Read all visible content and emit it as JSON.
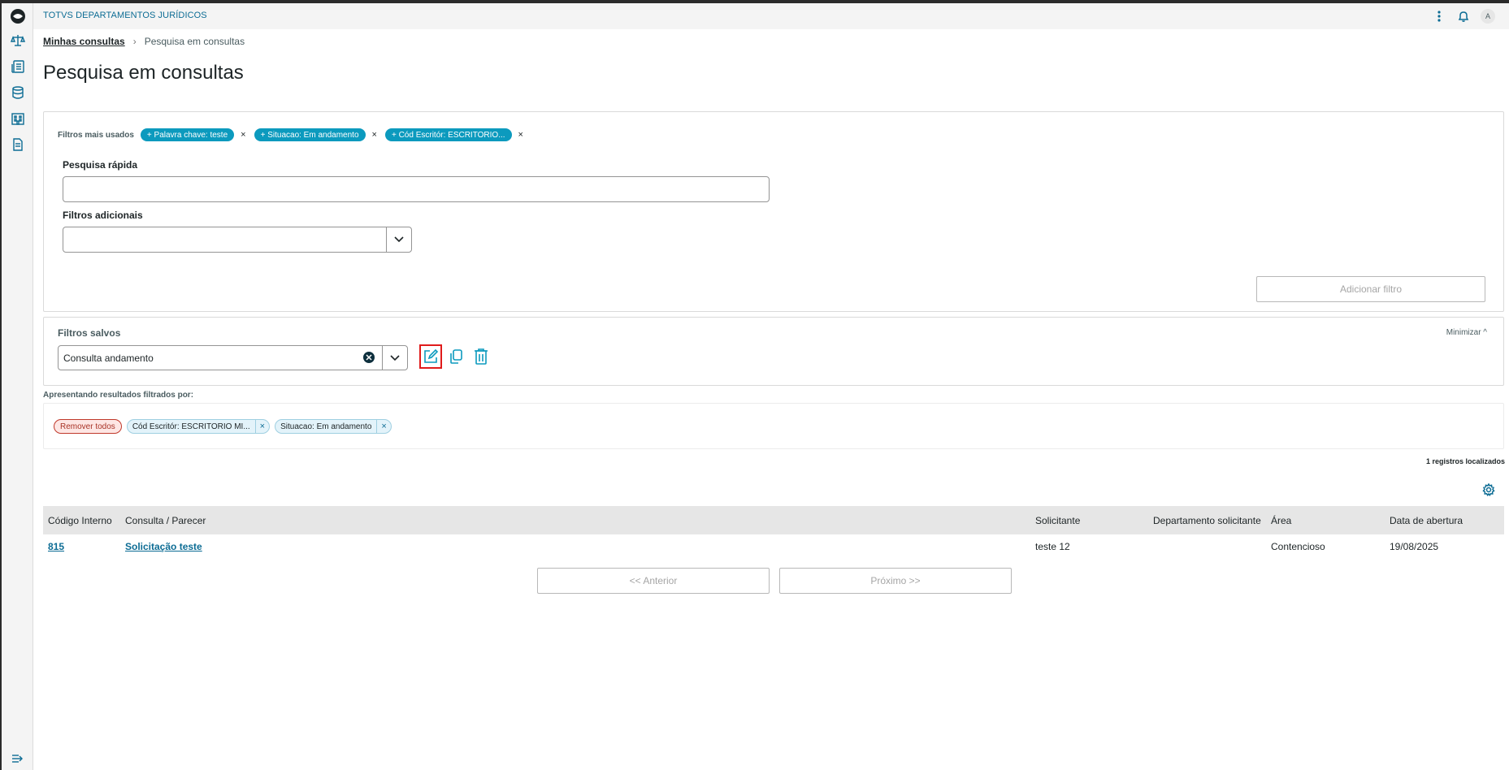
{
  "app": {
    "title": "TOTVS DEPARTAMENTOS JURÍDICOS",
    "user_initial": "A"
  },
  "sidebar": {
    "items": [
      "logo-icon",
      "scales-icon",
      "dashboard-icon",
      "database-icon",
      "building-icon",
      "document-icon"
    ],
    "collapse_icon": "collapse-menu-icon"
  },
  "breadcrumb": {
    "parent": "Minhas consultas",
    "current": "Pesquisa em consultas"
  },
  "page": {
    "title": "Pesquisa em consultas"
  },
  "filters_panel": {
    "most_used_label": "Filtros mais usados",
    "chips": [
      "+ Palavra chave: teste",
      "+ Situacao: Em andamento",
      "+ Cód Escritór: ESCRITORIO..."
    ],
    "chip_close": "×",
    "quick_search_label": "Pesquisa rápida",
    "quick_search_value": "",
    "additional_filters_label": "Filtros adicionais",
    "additional_filters_value": "",
    "add_filter_button": "Adicionar filtro"
  },
  "saved_filters": {
    "label": "Filtros salvos",
    "minimize_label": "Minimizar ^",
    "selected": "Consulta andamento"
  },
  "results": {
    "filtered_by_label": "Apresentando resultados filtrados por:",
    "remove_all": "Remover todos",
    "active_filters": [
      "Cód Escritór: ESCRITORIO MI...",
      "Situacao: Em andamento"
    ],
    "filter_close": "×",
    "count_text": "1 registros localizados"
  },
  "table": {
    "columns": [
      "Código Interno",
      "Consulta / Parecer",
      "Solicitante",
      "Departamento solicitante",
      "Área",
      "Data de abertura"
    ],
    "rows": [
      [
        "815",
        "Solicitação teste",
        "teste 12",
        "",
        "Contencioso",
        "19/08/2025"
      ]
    ]
  },
  "pagination": {
    "previous": "<< Anterior",
    "next": "Próximo >>"
  },
  "colors": {
    "accent": "#0c9abe",
    "link": "#0c6c94",
    "highlight_border": "#e01b1b",
    "remove_chip": "#c0392b"
  }
}
